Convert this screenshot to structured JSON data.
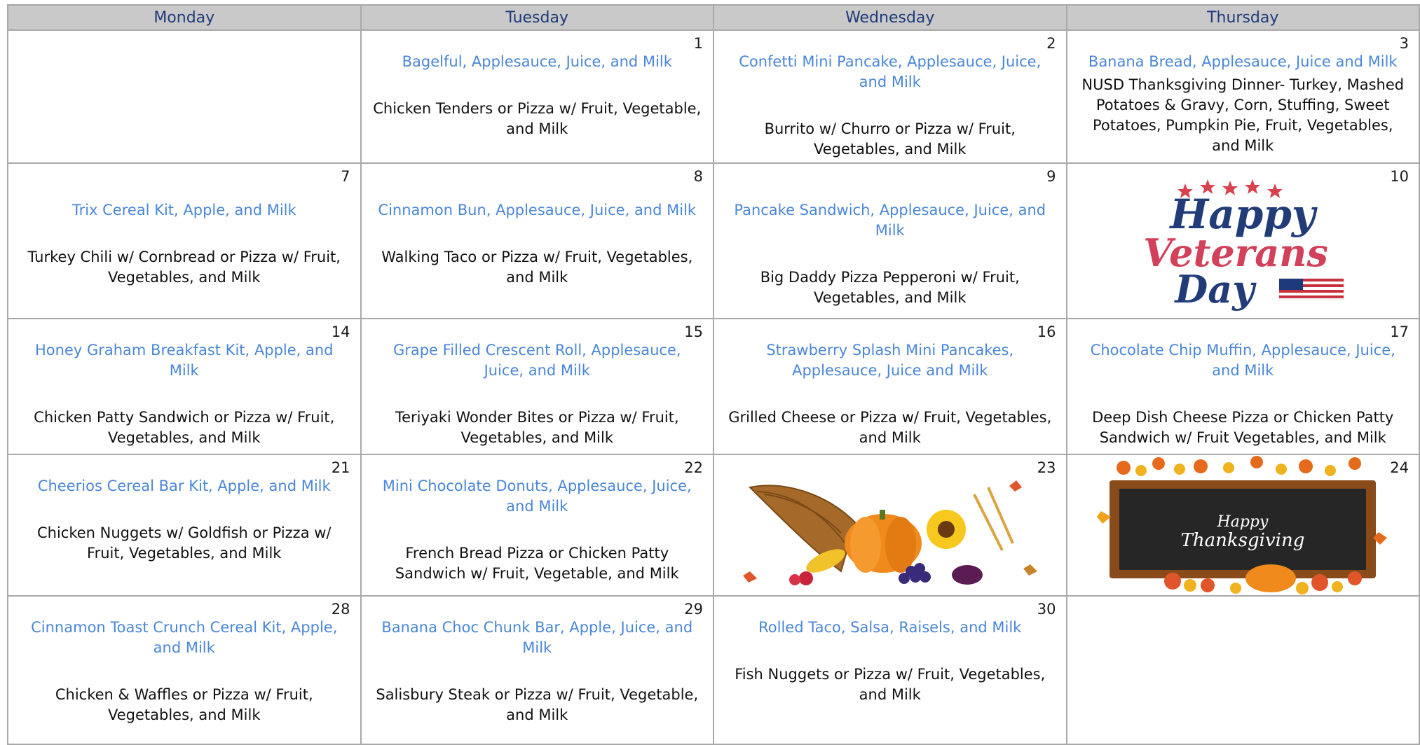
{
  "headers": [
    "Monday",
    "Tuesday",
    "Wednesday",
    "Thursday"
  ],
  "weeks": [
    [
      {
        "day": "",
        "breakfast": "",
        "lunch": ""
      },
      {
        "day": "1",
        "breakfast": "Bagelful, Applesauce, Juice, and Milk",
        "lunch": "Chicken Tenders or Pizza w/ Fruit, Vegetable, and Milk"
      },
      {
        "day": "2",
        "breakfast": "Confetti Mini Pancake, Applesauce, Juice, and Milk",
        "lunch": "Burrito w/ Churro or Pizza w/ Fruit, Vegetables, and Milk"
      },
      {
        "day": "3",
        "breakfast": "Banana Bread, Applesauce, Juice and Milk",
        "lunch": "NUSD Thanksgiving Dinner- Turkey, Mashed Potatoes & Gravy, Corn, Stuffing, Sweet Potatoes, Pumpkin Pie, Fruit, Vegetables, and Milk"
      }
    ],
    [
      {
        "day": "7",
        "breakfast": "Trix Cereal Kit, Apple, and Milk",
        "lunch": "Turkey Chili w/ Cornbread or Pizza w/ Fruit, Vegetables, and Milk"
      },
      {
        "day": "8",
        "breakfast": "Cinnamon Bun, Applesauce, Juice, and Milk",
        "lunch": "Walking Taco or Pizza w/ Fruit, Vegetables, and Milk"
      },
      {
        "day": "9",
        "breakfast": "Pancake Sandwich, Applesauce, Juice, and Milk",
        "lunch": "Big Daddy Pizza Pepperoni w/ Fruit, Vegetables, and Milk"
      },
      {
        "day": "10",
        "image": "happy-veterans-day",
        "image_text": [
          "Happy",
          "Veterans",
          "Day"
        ]
      }
    ],
    [
      {
        "day": "14",
        "breakfast": "Honey Graham Breakfast Kit, Apple, and Milk",
        "lunch": "Chicken Patty Sandwich or Pizza w/ Fruit, Vegetables, and Milk"
      },
      {
        "day": "15",
        "breakfast": "Grape Filled Crescent Roll, Applesauce, Juice, and Milk",
        "lunch": "Teriyaki Wonder Bites or Pizza w/ Fruit, Vegetables, and Milk"
      },
      {
        "day": "16",
        "breakfast": "Strawberry Splash Mini Pancakes, Applesauce, Juice and Milk",
        "lunch": "Grilled Cheese or Pizza w/ Fruit, Vegetables, and Milk"
      },
      {
        "day": "17",
        "breakfast": "Chocolate Chip Muffin, Applesauce, Juice, and Milk",
        "lunch": "Deep Dish Cheese Pizza or Chicken Patty Sandwich w/ Fruit Vegetables, and Milk"
      }
    ],
    [
      {
        "day": "21",
        "breakfast": "Cheerios Cereal Bar Kit, Apple, and Milk",
        "lunch": "Chicken Nuggets w/ Goldfish or Pizza w/ Fruit, Vegetables, and Milk"
      },
      {
        "day": "22",
        "breakfast": "Mini Chocolate Donuts, Applesauce, Juice, and Milk",
        "lunch": "French Bread Pizza or Chicken Patty Sandwich w/ Fruit, Vegetable, and Milk"
      },
      {
        "day": "23",
        "image": "cornucopia"
      },
      {
        "day": "24",
        "image": "happy-thanksgiving-sign",
        "image_text": [
          "Happy",
          "Thanksgiving"
        ]
      }
    ],
    [
      {
        "day": "28",
        "breakfast": "Cinnamon Toast Crunch Cereal Kit, Apple, and Milk",
        "lunch": "Chicken & Waffles or Pizza w/ Fruit, Vegetables, and Milk"
      },
      {
        "day": "29",
        "breakfast": "Banana Choc Chunk Bar, Apple, Juice, and Milk",
        "lunch": "Salisbury Steak or Pizza w/ Fruit, Vegetable, and Milk"
      },
      {
        "day": "30",
        "breakfast": "Rolled Taco, Salsa, Raisels, and Milk",
        "lunch": "Fish Nuggets or Pizza w/ Fruit, Vegetables, and Milk"
      },
      {
        "day": "",
        "breakfast": "",
        "lunch": ""
      }
    ]
  ],
  "colors": {
    "header_bg": "#c9c9c9",
    "header_text": "#1f3a7a",
    "breakfast_text": "#4a86d8",
    "lunch_text": "#111111",
    "grid": "#a9a9a9"
  }
}
